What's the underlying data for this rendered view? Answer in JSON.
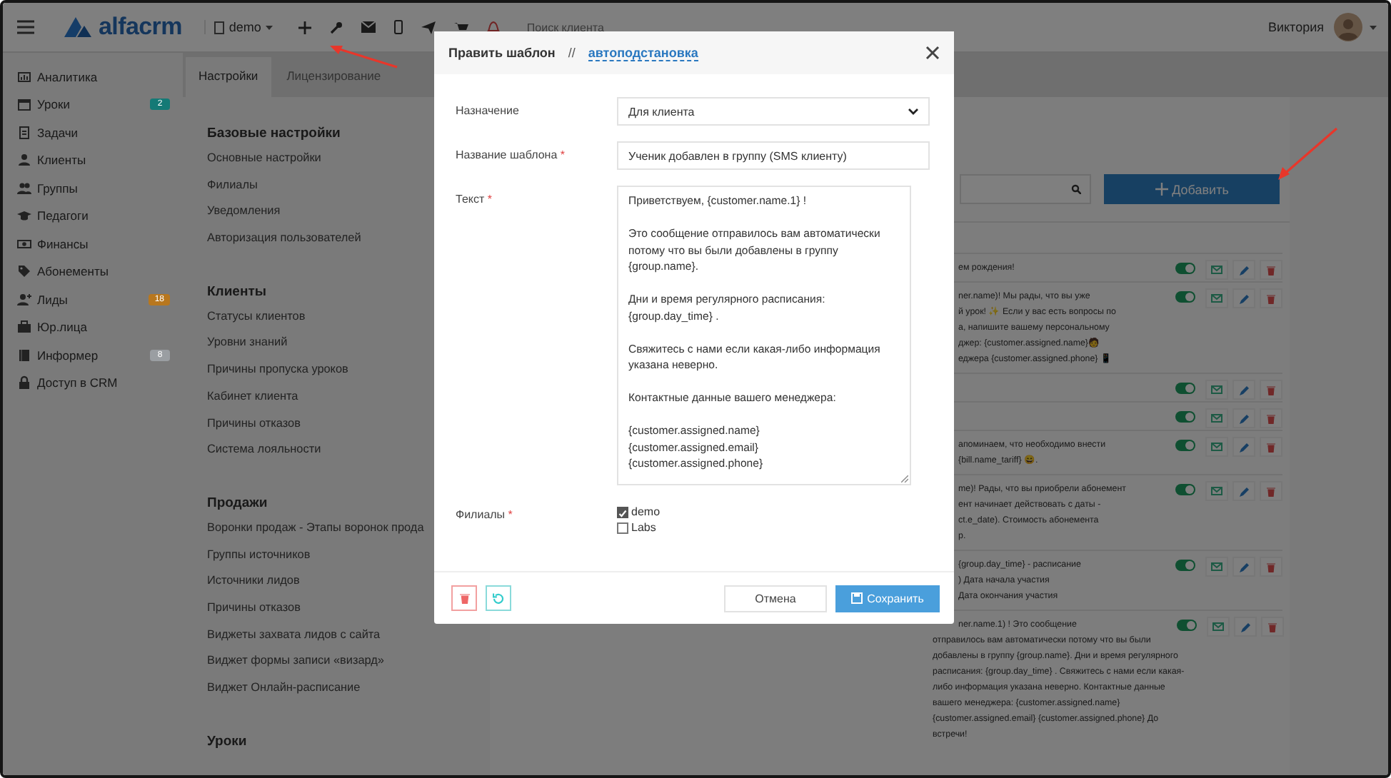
{
  "topbar": {
    "logo": "alfacrm",
    "branch": "demo",
    "search": {
      "placeholder": "Поиск клиента"
    },
    "user": "Виктория"
  },
  "sidebar": {
    "items": [
      {
        "label": "Аналитика"
      },
      {
        "label": "Уроки",
        "badge": {
          "text": "2",
          "color": "#147a76"
        }
      },
      {
        "label": "Задачи"
      },
      {
        "label": "Клиенты"
      },
      {
        "label": "Группы"
      },
      {
        "label": "Педагоги"
      },
      {
        "label": "Финансы"
      },
      {
        "label": "Абонементы"
      },
      {
        "label": "Лиды",
        "badge": {
          "text": "18",
          "color": "#b8771e"
        }
      },
      {
        "label": "Юр.лица"
      },
      {
        "label": "Информер",
        "badge": {
          "text": "8",
          "color": "#9a9ea2"
        }
      },
      {
        "label": "Доступ в CRM"
      }
    ]
  },
  "tabs": [
    {
      "label": "Настройки",
      "selected": true
    },
    {
      "label": "Лицензирование",
      "selected": false
    }
  ],
  "settings": {
    "sections": [
      {
        "title": "Базовые настройки",
        "links": [
          "Основные настройки",
          "Филиалы",
          "Уведомления",
          "Авторизация пользователей"
        ]
      },
      {
        "title": "Клиенты",
        "links": [
          "Статусы клиентов",
          "Уровни знаний",
          "Причины пропуска уроков",
          "Кабинет клиента",
          "Причины отказов",
          "Система лояльности"
        ]
      },
      {
        "title": "Продажи",
        "links": [
          "Воронки продаж - Этапы воронок прода",
          "Группы источников",
          "Источники лидов",
          "Причины отказов",
          "Виджеты захвата лидов с сайта",
          "Виджет формы записи «визард»",
          "Виджет Онлайн-расписание"
        ]
      },
      {
        "title": "Уроки"
      }
    ]
  },
  "templates": {
    "add_button": "Добавить",
    "rows": [
      {
        "enabled": true,
        "fragments": [
          "ем рождения!"
        ]
      },
      {
        "enabled": true,
        "fragments": [
          "ner.name)! Мы рады, что вы уже",
          "й урок! ✨ Если у вас есть вопросы по",
          "а, напишите вашему персональному",
          "джер: {customer.assigned.name}🧑",
          "еджера {customer.assigned.phone} 📱"
        ]
      },
      {
        "enabled": true
      },
      {
        "enabled": true
      },
      {
        "enabled": true,
        "fragments": [
          "апоминаем, что необходимо внести",
          "{bill.name_tariff} 😄."
        ]
      },
      {
        "enabled": true,
        "fragments": [
          "me)! Рады, что вы приобрели абонемент",
          "ент начинает действовать с даты -",
          "ct.e_date). Стоимость абонемента",
          "р."
        ]
      },
      {
        "enabled": true,
        "fragments": [
          "{group.day_time} - расписание",
          ") Дата начала участия",
          "Дата окончания участия"
        ]
      },
      {
        "enabled": true,
        "fragments": [
          "ner.name.1) ! Это сообщение"
        ],
        "lines": [
          "отправилось вам автоматически потому что вы были",
          "добавлены в группу {group.name}. Дни и время регулярного",
          "расписания: {group.day_time} . Свяжитесь с нами если какая-",
          "либо информация указана неверно. Контактные данные",
          "вашего менеджера: {customer.assigned.name}",
          "{customer.assigned.email} {customer.assigned.phone} До",
          "встречи!"
        ]
      }
    ]
  },
  "dialog": {
    "title": "Править шаблон",
    "separator": "//",
    "link": "автоподстановка",
    "fields": [
      {
        "kind": "select",
        "label": "Назначение",
        "value": "Для клиента"
      },
      {
        "kind": "input",
        "label": "Название шаблона",
        "mark": "*",
        "value": "Ученик добавлен в группу (SMS клиенту)"
      },
      {
        "kind": "textarea",
        "label": "Текст",
        "mark": "*",
        "value": "Приветствуем, {customer.name.1} !\n\nЭто сообщение отправилось вам автоматически потому что вы были добавлены в группу {group.name}.\n\nДни и время регулярного расписания: {group.day_time} .\n\nСвяжитесь с нами если какая-либо информация указана неверно.\n\nКонтактные данные вашего менеджера:\n\n{customer.assigned.name}\n{customer.assigned.email}\n{customer.assigned.phone}"
      },
      {
        "kind": "checkboxes",
        "label": "Филиалы",
        "mark": "*",
        "options": [
          {
            "label": "demo",
            "checked": true
          },
          {
            "label": "Labs",
            "checked": false
          }
        ]
      }
    ],
    "cancel": "Отмена",
    "save": "Сохранить"
  }
}
